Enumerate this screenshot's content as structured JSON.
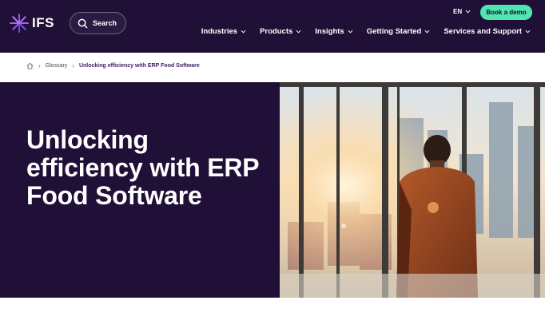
{
  "brand": {
    "logo_text": "IFS"
  },
  "search": {
    "label": "Search"
  },
  "language": {
    "code": "EN"
  },
  "cta": {
    "demo_label": "Book a demo"
  },
  "nav": {
    "items": [
      {
        "label": "Industries"
      },
      {
        "label": "Products"
      },
      {
        "label": "Insights"
      },
      {
        "label": "Getting Started"
      },
      {
        "label": "Services and Support"
      }
    ]
  },
  "breadcrumb": {
    "items": [
      {
        "label": "Glossary"
      },
      {
        "label": "Unlocking efficiency with ERP Food Software"
      }
    ]
  },
  "hero": {
    "title": "Unlocking efficiency with ERP Food Software"
  },
  "colors": {
    "header_bg": "#200f36",
    "accent_green": "#4fe6b0",
    "breadcrumb_current": "#3c1e64"
  }
}
